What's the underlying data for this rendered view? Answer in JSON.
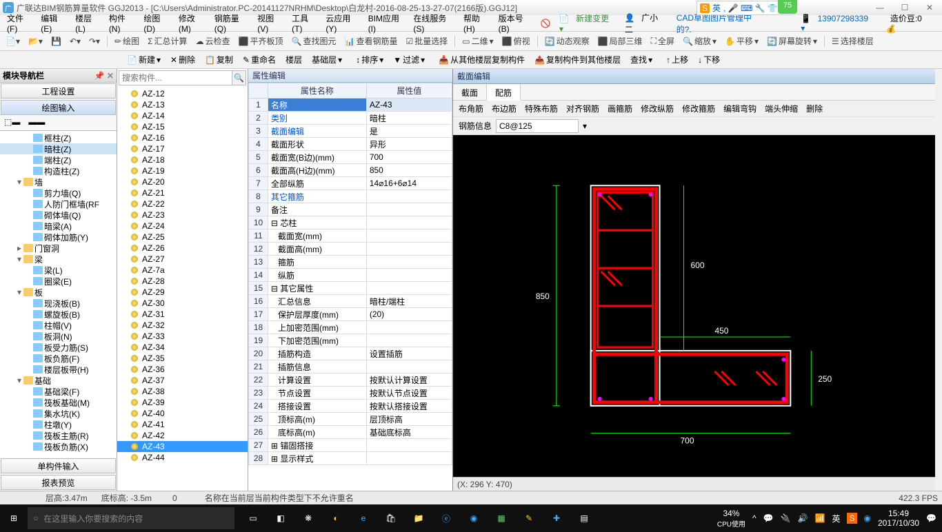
{
  "title": "广联达BIM钢筋算量软件 GGJ2013 - [C:\\Users\\Administrator.PC-20141127NRHM\\Desktop\\白龙村-2016-08-25-13-27-07(2166版).GGJ12]",
  "ime": {
    "label": "英",
    "badge": "75"
  },
  "menubar": [
    "文件(F)",
    "编辑(E)",
    "楼层(L)",
    "构件(N)",
    "绘图(D)",
    "修改(M)",
    "钢筋量(Q)",
    "视图(V)",
    "工具(T)",
    "云应用(Y)",
    "BIM应用(I)",
    "在线服务(S)",
    "帮助(H)",
    "版本号(B)"
  ],
  "menuright": {
    "new": "新建变更",
    "user": "广小二",
    "cad": "CAD草图图片管理中的?.",
    "phone": "13907298339",
    "beans": "造价豆:0"
  },
  "toolbar1": [
    "绘图",
    "汇总计算",
    "云检查",
    "平齐板顶",
    "查找图元",
    "查看钢筋量",
    "批量选择"
  ],
  "toolbar1b": {
    "view": "二维",
    "views": [
      "俯视",
      "动态观察",
      "局部三维",
      "全屏",
      "缩放",
      "平移",
      "屏幕旋转",
      "选择楼层"
    ]
  },
  "toolbar2": [
    "新建",
    "删除",
    "复制",
    "重命名",
    "楼层",
    "基础层"
  ],
  "toolbar2b": [
    "排序",
    "过滤",
    "从其他楼层复制构件",
    "复制构件到其他楼层",
    "查找",
    "上移",
    "下移"
  ],
  "nav": {
    "title": "模块导航栏",
    "buttons": [
      "工程设置",
      "绘图输入",
      "单构件输入",
      "报表预览"
    ]
  },
  "tree": [
    {
      "t": "框柱(Z)",
      "l": 2
    },
    {
      "t": "暗柱(Z)",
      "l": 2,
      "sel": true
    },
    {
      "t": "端柱(Z)",
      "l": 2
    },
    {
      "t": "构造柱(Z)",
      "l": 2
    },
    {
      "t": "墙",
      "l": 1,
      "exp": "v"
    },
    {
      "t": "剪力墙(Q)",
      "l": 2
    },
    {
      "t": "人防门框墙(RF",
      "l": 2
    },
    {
      "t": "砌体墙(Q)",
      "l": 2
    },
    {
      "t": "暗梁(A)",
      "l": 2
    },
    {
      "t": "砌体加筋(Y)",
      "l": 2
    },
    {
      "t": "门窗洞",
      "l": 1,
      "exp": ">"
    },
    {
      "t": "梁",
      "l": 1,
      "exp": "v"
    },
    {
      "t": "梁(L)",
      "l": 2
    },
    {
      "t": "圈梁(E)",
      "l": 2
    },
    {
      "t": "板",
      "l": 1,
      "exp": "v"
    },
    {
      "t": "现浇板(B)",
      "l": 2
    },
    {
      "t": "螺旋板(B)",
      "l": 2
    },
    {
      "t": "柱帽(V)",
      "l": 2
    },
    {
      "t": "板洞(N)",
      "l": 2
    },
    {
      "t": "板受力筋(S)",
      "l": 2
    },
    {
      "t": "板负筋(F)",
      "l": 2
    },
    {
      "t": "楼层板带(H)",
      "l": 2
    },
    {
      "t": "基础",
      "l": 1,
      "exp": "v"
    },
    {
      "t": "基础梁(F)",
      "l": 2
    },
    {
      "t": "筏板基础(M)",
      "l": 2
    },
    {
      "t": "集水坑(K)",
      "l": 2
    },
    {
      "t": "柱墩(Y)",
      "l": 2
    },
    {
      "t": "筏板主筋(R)",
      "l": 2
    },
    {
      "t": "筏板负筋(X)",
      "l": 2
    }
  ],
  "search": {
    "ph": "搜索构件..."
  },
  "items": [
    "AZ-12",
    "AZ-13",
    "AZ-14",
    "AZ-15",
    "AZ-16",
    "AZ-17",
    "AZ-18",
    "AZ-19",
    "AZ-20",
    "AZ-21",
    "AZ-22",
    "AZ-23",
    "AZ-24",
    "AZ-25",
    "AZ-26",
    "AZ-27",
    "AZ-7a",
    "AZ-28",
    "AZ-29",
    "AZ-30",
    "AZ-31",
    "AZ-32",
    "AZ-33",
    "AZ-34",
    "AZ-35",
    "AZ-36",
    "AZ-37",
    "AZ-38",
    "AZ-39",
    "AZ-40",
    "AZ-41",
    "AZ-42",
    "AZ-43",
    "AZ-44"
  ],
  "itemSel": "AZ-43",
  "prop": {
    "title": "属性编辑",
    "cols": [
      "属性名称",
      "属性值"
    ]
  },
  "props": [
    {
      "n": "名称",
      "v": "AZ-43",
      "sel": true
    },
    {
      "n": "类别",
      "v": "暗柱",
      "blue": true
    },
    {
      "n": "截面编辑",
      "v": "是",
      "blue": true
    },
    {
      "n": "截面形状",
      "v": "异形"
    },
    {
      "n": "截面宽(B边)(mm)",
      "v": "700"
    },
    {
      "n": "截面高(H边)(mm)",
      "v": "850"
    },
    {
      "n": "全部纵筋",
      "v": "14⌀16+6⌀14"
    },
    {
      "n": "其它箍筋",
      "v": "",
      "blue": true
    },
    {
      "n": "备注",
      "v": ""
    },
    {
      "n": "芯柱",
      "v": "",
      "grp": true
    },
    {
      "n": "截面宽(mm)",
      "v": "",
      "sub": true
    },
    {
      "n": "截面高(mm)",
      "v": "",
      "sub": true
    },
    {
      "n": "箍筋",
      "v": "",
      "sub": true
    },
    {
      "n": "纵筋",
      "v": "",
      "sub": true
    },
    {
      "n": "其它属性",
      "v": "",
      "grp": true
    },
    {
      "n": "汇总信息",
      "v": "暗柱/端柱",
      "sub": true
    },
    {
      "n": "保护层厚度(mm)",
      "v": "(20)",
      "sub": true
    },
    {
      "n": "上加密范围(mm)",
      "v": "",
      "sub": true
    },
    {
      "n": "下加密范围(mm)",
      "v": "",
      "sub": true
    },
    {
      "n": "插筋构造",
      "v": "设置插筋",
      "sub": true
    },
    {
      "n": "插筋信息",
      "v": "",
      "sub": true
    },
    {
      "n": "计算设置",
      "v": "按默认计算设置",
      "sub": true
    },
    {
      "n": "节点设置",
      "v": "按默认节点设置",
      "sub": true
    },
    {
      "n": "搭接设置",
      "v": "按默认搭接设置",
      "sub": true
    },
    {
      "n": "顶标高(m)",
      "v": "层顶标高",
      "sub": true
    },
    {
      "n": "底标高(m)",
      "v": "基础底标高",
      "sub": true
    },
    {
      "n": "锚固搭接",
      "v": "",
      "grp": true,
      "plus": true
    },
    {
      "n": "显示样式",
      "v": "",
      "grp": true,
      "plus": true
    }
  ],
  "section": {
    "title": "截面编辑",
    "tabs": [
      "截面",
      "配筋"
    ],
    "active": "配筋",
    "tools": [
      "布角筋",
      "布边筋",
      "特殊布筋",
      "对齐钢筋",
      "画箍筋",
      "修改纵筋",
      "修改箍筋",
      "编辑弯钩",
      "端头伸缩",
      "删除"
    ],
    "info": {
      "label": "钢筋信息",
      "value": "C8@125"
    },
    "coord": "(X: 296 Y: 470)"
  },
  "dims": {
    "h": "850",
    "w": "700",
    "h2": "600",
    "w2": "450",
    "h3": "250"
  },
  "status": {
    "floor": "层高:3.47m",
    "bottom": "底标高: -3.5m",
    "zero": "0",
    "msg": "名称在当前层当前构件类型下不允许重名",
    "fps": "422.3 FPS"
  },
  "taskbar": {
    "search": "在这里输入你要搜索的内容",
    "cpu": "34%",
    "cpulabel": "CPU使用",
    "time": "15:49",
    "date": "2017/10/30"
  }
}
